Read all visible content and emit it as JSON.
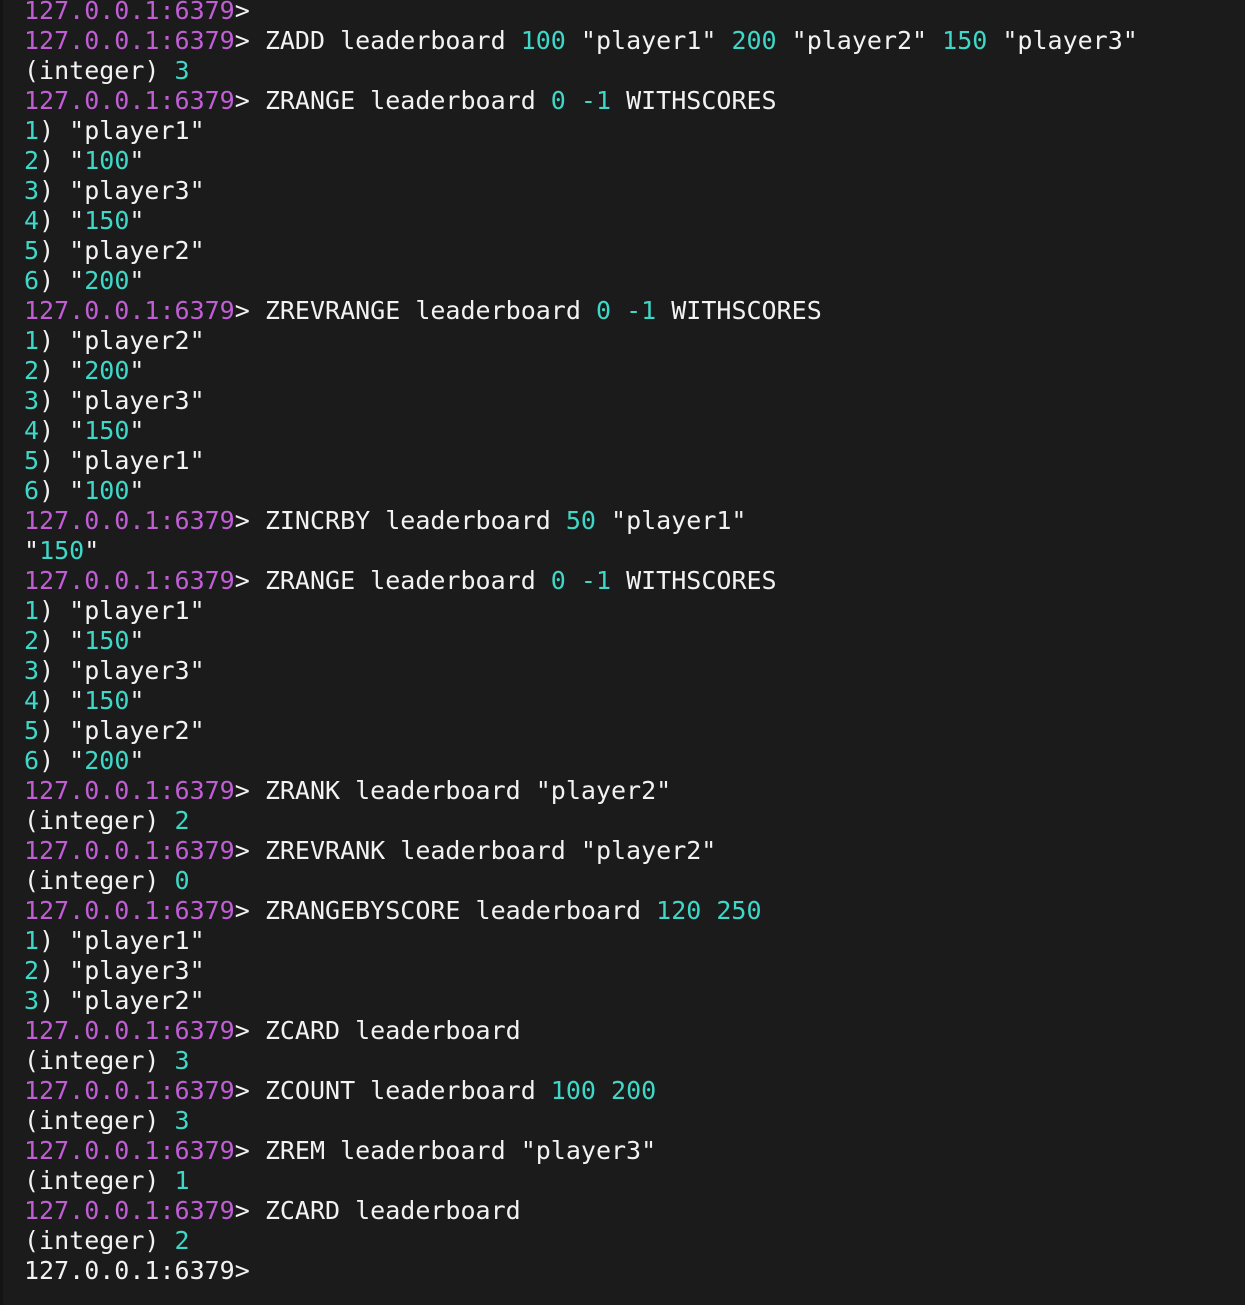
{
  "colors": {
    "background": "#1b1b1b",
    "prompt": "#c15ed6",
    "text": "#f2f2f2",
    "number": "#3ed8c8"
  },
  "terminal": {
    "lines": [
      [
        [
          "p",
          "127.0.0.1:6379"
        ],
        [
          "t",
          ">"
        ]
      ],
      [
        [
          "p",
          "127.0.0.1:6379"
        ],
        [
          "t",
          "> ZADD leaderboard "
        ],
        [
          "n",
          "100"
        ],
        [
          "t",
          " \"player1\" "
        ],
        [
          "n",
          "200"
        ],
        [
          "t",
          " \"player2\" "
        ],
        [
          "n",
          "150"
        ],
        [
          "t",
          " \"player3\""
        ]
      ],
      [
        [
          "t",
          "(integer) "
        ],
        [
          "n",
          "3"
        ]
      ],
      [
        [
          "p",
          "127.0.0.1:6379"
        ],
        [
          "t",
          "> ZRANGE leaderboard "
        ],
        [
          "n",
          "0"
        ],
        [
          "t",
          " "
        ],
        [
          "n",
          "-1"
        ],
        [
          "t",
          " WITHSCORES"
        ]
      ],
      [
        [
          "n",
          "1"
        ],
        [
          "t",
          ") \"player1\""
        ]
      ],
      [
        [
          "n",
          "2"
        ],
        [
          "t",
          ") \""
        ],
        [
          "n",
          "100"
        ],
        [
          "t",
          "\""
        ]
      ],
      [
        [
          "n",
          "3"
        ],
        [
          "t",
          ") \"player3\""
        ]
      ],
      [
        [
          "n",
          "4"
        ],
        [
          "t",
          ") \""
        ],
        [
          "n",
          "150"
        ],
        [
          "t",
          "\""
        ]
      ],
      [
        [
          "n",
          "5"
        ],
        [
          "t",
          ") \"player2\""
        ]
      ],
      [
        [
          "n",
          "6"
        ],
        [
          "t",
          ") \""
        ],
        [
          "n",
          "200"
        ],
        [
          "t",
          "\""
        ]
      ],
      [
        [
          "p",
          "127.0.0.1:6379"
        ],
        [
          "t",
          "> ZREVRANGE leaderboard "
        ],
        [
          "n",
          "0"
        ],
        [
          "t",
          " "
        ],
        [
          "n",
          "-1"
        ],
        [
          "t",
          " WITHSCORES"
        ]
      ],
      [
        [
          "n",
          "1"
        ],
        [
          "t",
          ") \"player2\""
        ]
      ],
      [
        [
          "n",
          "2"
        ],
        [
          "t",
          ") \""
        ],
        [
          "n",
          "200"
        ],
        [
          "t",
          "\""
        ]
      ],
      [
        [
          "n",
          "3"
        ],
        [
          "t",
          ") \"player3\""
        ]
      ],
      [
        [
          "n",
          "4"
        ],
        [
          "t",
          ") \""
        ],
        [
          "n",
          "150"
        ],
        [
          "t",
          "\""
        ]
      ],
      [
        [
          "n",
          "5"
        ],
        [
          "t",
          ") \"player1\""
        ]
      ],
      [
        [
          "n",
          "6"
        ],
        [
          "t",
          ") \""
        ],
        [
          "n",
          "100"
        ],
        [
          "t",
          "\""
        ]
      ],
      [
        [
          "p",
          "127.0.0.1:6379"
        ],
        [
          "t",
          "> ZINCRBY leaderboard "
        ],
        [
          "n",
          "50"
        ],
        [
          "t",
          " \"player1\""
        ]
      ],
      [
        [
          "t",
          "\""
        ],
        [
          "n",
          "150"
        ],
        [
          "t",
          "\""
        ]
      ],
      [
        [
          "p",
          "127.0.0.1:6379"
        ],
        [
          "t",
          "> ZRANGE leaderboard "
        ],
        [
          "n",
          "0"
        ],
        [
          "t",
          " "
        ],
        [
          "n",
          "-1"
        ],
        [
          "t",
          " WITHSCORES"
        ]
      ],
      [
        [
          "n",
          "1"
        ],
        [
          "t",
          ") \"player1\""
        ]
      ],
      [
        [
          "n",
          "2"
        ],
        [
          "t",
          ") \""
        ],
        [
          "n",
          "150"
        ],
        [
          "t",
          "\""
        ]
      ],
      [
        [
          "n",
          "3"
        ],
        [
          "t",
          ") \"player3\""
        ]
      ],
      [
        [
          "n",
          "4"
        ],
        [
          "t",
          ") \""
        ],
        [
          "n",
          "150"
        ],
        [
          "t",
          "\""
        ]
      ],
      [
        [
          "n",
          "5"
        ],
        [
          "t",
          ") \"player2\""
        ]
      ],
      [
        [
          "n",
          "6"
        ],
        [
          "t",
          ") \""
        ],
        [
          "n",
          "200"
        ],
        [
          "t",
          "\""
        ]
      ],
      [
        [
          "p",
          "127.0.0.1:6379"
        ],
        [
          "t",
          "> ZRANK leaderboard \"player2\""
        ]
      ],
      [
        [
          "t",
          "(integer) "
        ],
        [
          "n",
          "2"
        ]
      ],
      [
        [
          "p",
          "127.0.0.1:6379"
        ],
        [
          "t",
          "> ZREVRANK leaderboard \"player2\""
        ]
      ],
      [
        [
          "t",
          "(integer) "
        ],
        [
          "n",
          "0"
        ]
      ],
      [
        [
          "p",
          "127.0.0.1:6379"
        ],
        [
          "t",
          "> ZRANGEBYSCORE leaderboard "
        ],
        [
          "n",
          "120"
        ],
        [
          "t",
          " "
        ],
        [
          "n",
          "250"
        ]
      ],
      [
        [
          "n",
          "1"
        ],
        [
          "t",
          ") \"player1\""
        ]
      ],
      [
        [
          "n",
          "2"
        ],
        [
          "t",
          ") \"player3\""
        ]
      ],
      [
        [
          "n",
          "3"
        ],
        [
          "t",
          ") \"player2\""
        ]
      ],
      [
        [
          "p",
          "127.0.0.1:6379"
        ],
        [
          "t",
          "> ZCARD leaderboard"
        ]
      ],
      [
        [
          "t",
          "(integer) "
        ],
        [
          "n",
          "3"
        ]
      ],
      [
        [
          "p",
          "127.0.0.1:6379"
        ],
        [
          "t",
          "> ZCOUNT leaderboard "
        ],
        [
          "n",
          "100"
        ],
        [
          "t",
          " "
        ],
        [
          "n",
          "200"
        ]
      ],
      [
        [
          "t",
          "(integer) "
        ],
        [
          "n",
          "3"
        ]
      ],
      [
        [
          "p",
          "127.0.0.1:6379"
        ],
        [
          "t",
          "> ZREM leaderboard \"player3\""
        ]
      ],
      [
        [
          "t",
          "(integer) "
        ],
        [
          "n",
          "1"
        ]
      ],
      [
        [
          "p",
          "127.0.0.1:6379"
        ],
        [
          "t",
          "> ZCARD leaderboard"
        ]
      ],
      [
        [
          "t",
          "(integer) "
        ],
        [
          "n",
          "2"
        ]
      ],
      [
        [
          "w",
          "127.0.0.1:6379>"
        ]
      ]
    ]
  }
}
